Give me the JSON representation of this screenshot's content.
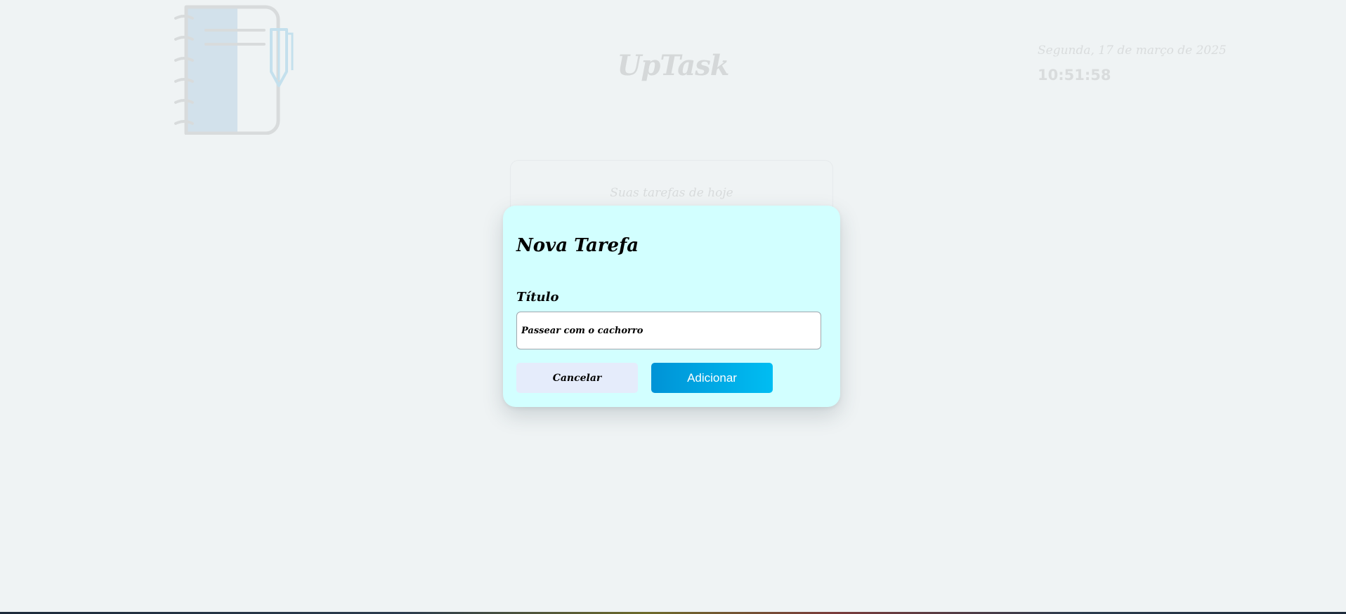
{
  "background": {
    "app_title": "UpTask",
    "date": "Segunda, 17 de março de 2025",
    "time": "10:51:58",
    "tasks_card_title": "Suas tarefas de hoje"
  },
  "modal": {
    "title": "Nova Tarefa",
    "field_label": "Título",
    "title_value": "Passear com o cachorro",
    "cancel_label": "Cancelar",
    "add_label": "Adicionar"
  },
  "colors": {
    "page_background": "#eff3f4",
    "modal_background": "#d2ffff",
    "add_button_gradient_start": "#0093d6",
    "add_button_gradient_end": "#00bdf2",
    "cancel_button_background": "#e5ecfb"
  },
  "icons": {
    "logo": "notebook-pen-icon"
  }
}
